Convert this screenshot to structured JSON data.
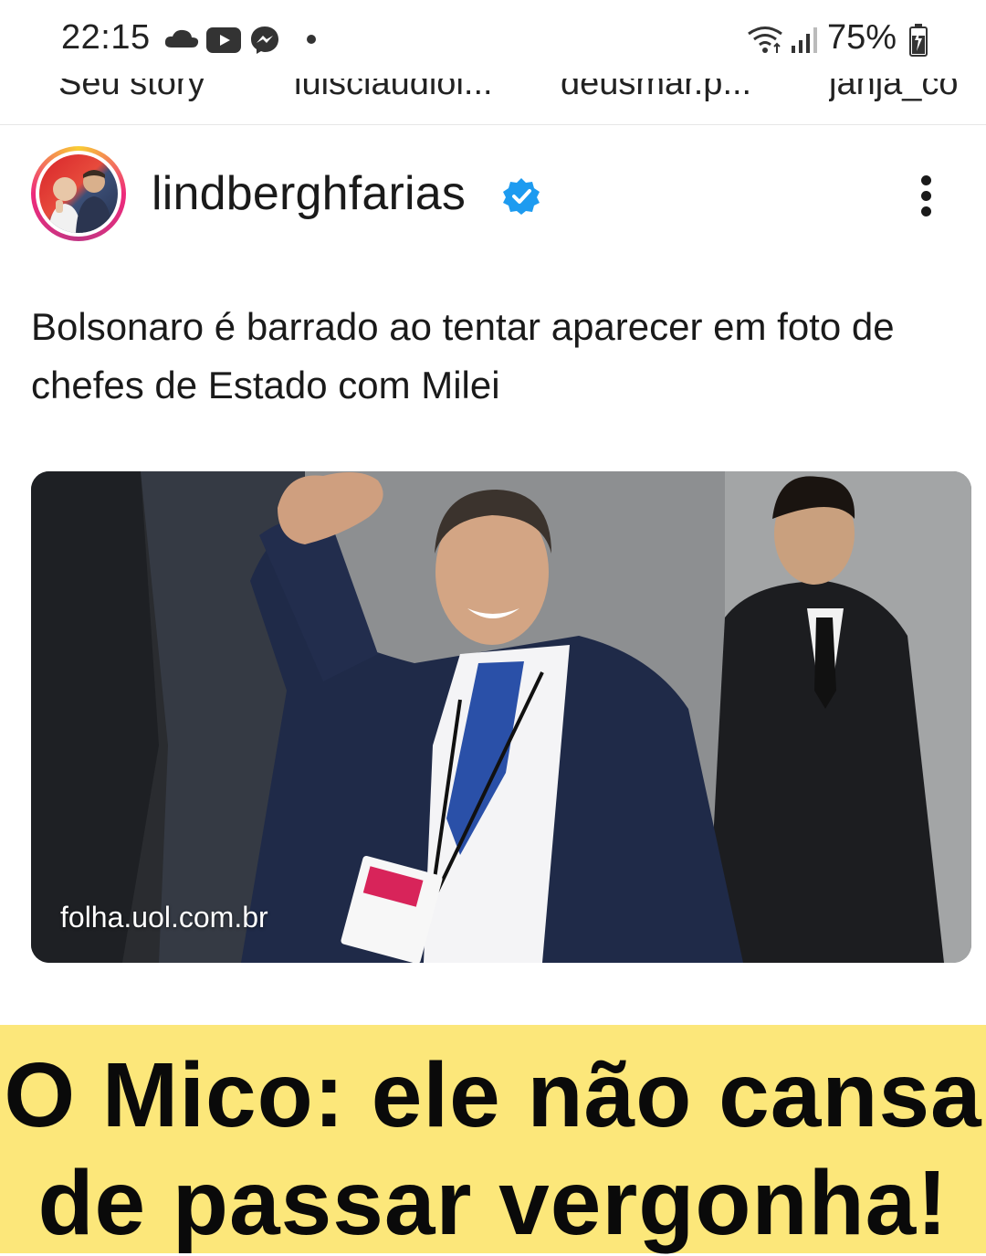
{
  "status_bar": {
    "time": "22:15",
    "battery": "75%",
    "left_icons": [
      "cloud-icon",
      "youtube-icon",
      "messenger-icon",
      "dot-icon"
    ],
    "right_icons": [
      "wifi-icon",
      "signal-icon",
      "battery-icon"
    ]
  },
  "stories": {
    "items": [
      {
        "label": "Seu story"
      },
      {
        "label": "luisclaudiol..."
      },
      {
        "label": "deusmar.p..."
      },
      {
        "label": "janja_co"
      }
    ]
  },
  "post": {
    "username": "lindberghfarias",
    "verified": true,
    "headline": "Bolsonaro é barrado ao tentar aparecer em foto de chefes de Estado com Milei",
    "link_source": "folha.uol.com.br"
  },
  "banner": {
    "line1": "O Mico: ele não cansa",
    "line2": "de passar vergonha!",
    "color": "#fce77a"
  },
  "colors": {
    "verified_badge": "#1d9bf0",
    "text": "#1a1a1a"
  }
}
